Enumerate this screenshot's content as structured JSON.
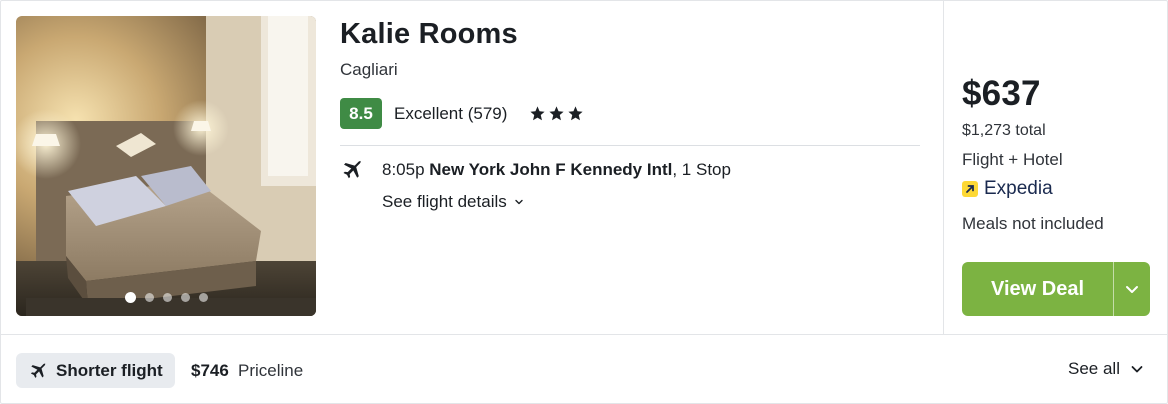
{
  "hotel": {
    "name": "Kalie Rooms",
    "city": "Cagliari",
    "score": "8.5",
    "rating_text": "Excellent (579)",
    "stars": 3,
    "photo_count": 5,
    "photo_active_index": 1
  },
  "flight": {
    "time": "8:05p",
    "airport": "New York John F Kennedy Intl",
    "stops": ", 1 Stop",
    "details_label": "See flight details"
  },
  "offer": {
    "price": "$637",
    "total": "$1,273 total",
    "package": "Flight + Hotel",
    "provider": "Expedia",
    "meals": "Meals not included",
    "cta_label": "View Deal"
  },
  "alternative": {
    "chip_label": "Shorter flight",
    "price": "$746",
    "provider": "Priceline",
    "see_all_label": "See all"
  },
  "colors": {
    "score_bg": "#3f8b45",
    "cta_bg": "#7cb342",
    "chip_bg": "#e8ebef",
    "expedia_yellow": "#fdd835"
  },
  "icons": {
    "flight": "plane-icon",
    "expand": "chevron-down-icon",
    "star": "star-icon"
  }
}
